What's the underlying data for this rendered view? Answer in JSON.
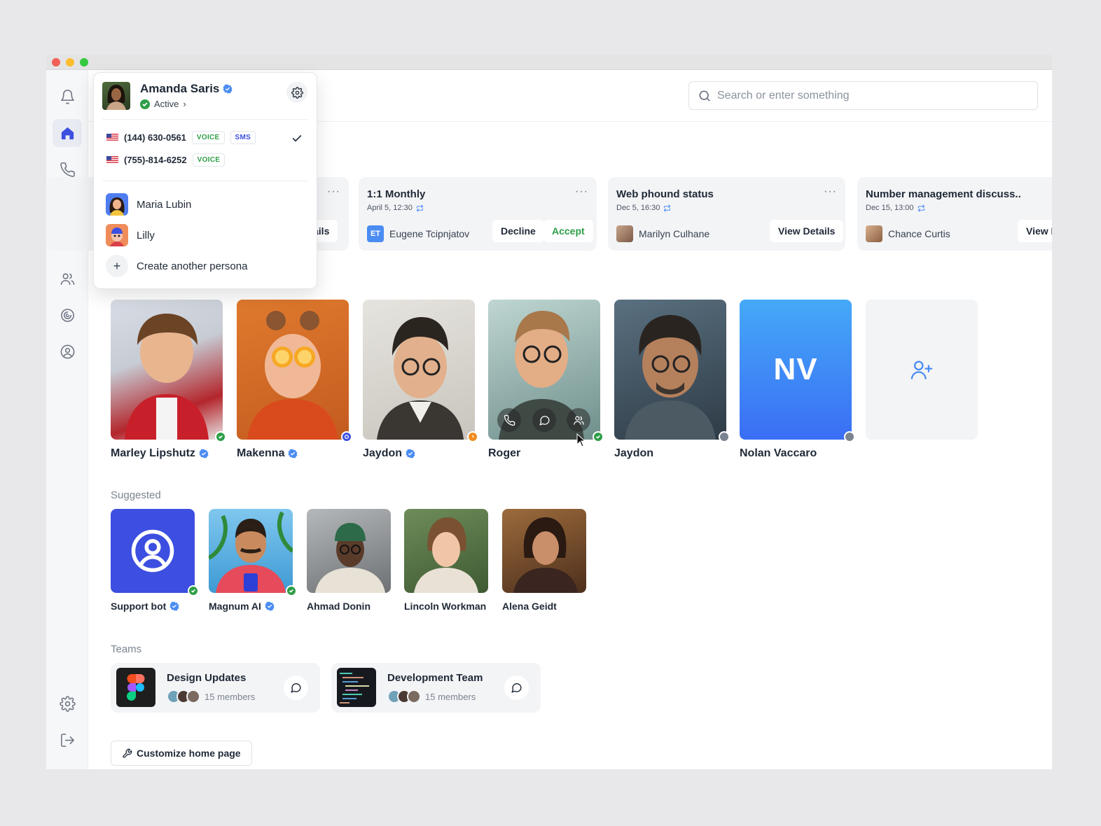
{
  "search": {
    "placeholder": "Search or enter something"
  },
  "events": [
    {
      "title": "",
      "date": "",
      "secondary_btn": "ails"
    },
    {
      "title": "1:1 Monthly",
      "date": "April 5, 12:30",
      "person": "Eugene Tcipnjatov",
      "initials": "ET",
      "decline": "Decline",
      "accept": "Accept"
    },
    {
      "title": "Web phound status",
      "date": "Dec 5, 16:30",
      "person": "Marilyn Culhane",
      "action": "View Details"
    },
    {
      "title": "Number management discuss..",
      "date": "Dec 15, 13:00",
      "person": "Chance Curtis",
      "action": "View D"
    }
  ],
  "contacts": [
    {
      "name": "Marley Lipshutz",
      "verified": true,
      "status": "online"
    },
    {
      "name": "Makenna",
      "verified": true,
      "status": "focus"
    },
    {
      "name": "Jaydon",
      "verified": true,
      "status": "away"
    },
    {
      "name": "Roger",
      "verified": false,
      "status": "online"
    },
    {
      "name": "Jaydon",
      "verified": false,
      "status": "offline"
    },
    {
      "name": "Nolan Vaccaro",
      "verified": false,
      "status": "offline",
      "initials": "NV"
    }
  ],
  "suggested": {
    "label": "Suggested",
    "items": [
      {
        "name": "Support bot",
        "verified": true
      },
      {
        "name": "Magnum AI",
        "verified": true
      },
      {
        "name": "Ahmad Donin"
      },
      {
        "name": "Lincoln Workman"
      },
      {
        "name": "Alena Geidt"
      }
    ]
  },
  "teams": {
    "label": "Teams",
    "items": [
      {
        "name": "Design Updates",
        "members": "15 members"
      },
      {
        "name": "Development Team",
        "members": "15 members"
      }
    ]
  },
  "customize_label": "Customize home page",
  "popover": {
    "user_name": "Amanda Saris",
    "status": "Active",
    "status_chevron": "›",
    "phones": [
      {
        "number": "(144) 630-0561",
        "tags": [
          "VOICE",
          "SMS"
        ],
        "selected": true
      },
      {
        "number": "(755)-814-6252",
        "tags": [
          "VOICE"
        ],
        "selected": false
      }
    ],
    "personas": [
      "Maria Lubin",
      "Lilly"
    ],
    "create_label": "Create another persona"
  },
  "colors": {
    "accent": "#3c4fe0",
    "online": "#2e9e47",
    "away": "#f08c1e",
    "offline": "#7b8390",
    "verified": "#4a8cf2"
  }
}
